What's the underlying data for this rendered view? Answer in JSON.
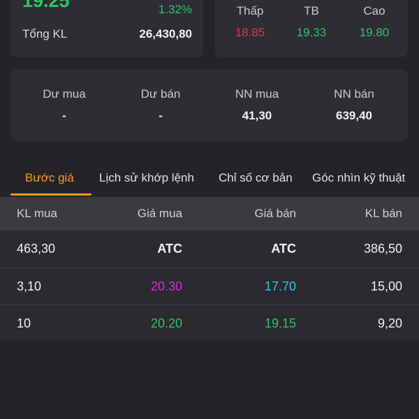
{
  "header": {
    "price_partial": "19.25",
    "change_pct": "1.32%",
    "volume_label": "Tổng KL",
    "volume_value": "26,430,80"
  },
  "range": {
    "low_label": "Thấp",
    "low_value": "18.85",
    "avg_label": "TB",
    "avg_value": "19.33",
    "high_label": "Cao",
    "high_value": "19.80"
  },
  "flow": {
    "items": [
      {
        "label": "Dư mua",
        "value": "-"
      },
      {
        "label": "Dư bán",
        "value": "-"
      },
      {
        "label": "NN mua",
        "value": "41,30"
      },
      {
        "label": "NN bán",
        "value": "639,40"
      }
    ]
  },
  "tabs": [
    {
      "label": "Bước giá"
    },
    {
      "label": "Lịch sử khớp lệnh"
    },
    {
      "label": "Chỉ số cơ bản"
    },
    {
      "label": "Góc nhìn kỹ thuật"
    }
  ],
  "book": {
    "headers": [
      "KL mua",
      "Giá mua",
      "Giá bán",
      "KL bán"
    ],
    "rows": [
      {
        "kl_mua": "463,30",
        "gia_mua": "ATC",
        "gia_ban": "ATC",
        "kl_ban": "386,50"
      },
      {
        "kl_mua": "3,10",
        "gia_mua": "20.30",
        "gia_ban": "17.70",
        "kl_ban": "15,00"
      },
      {
        "kl_mua": "10",
        "gia_mua": "20.20",
        "gia_ban": "19.15",
        "kl_ban": "9,20"
      }
    ]
  },
  "colors": {
    "up": "#2fc46b",
    "down": "#e8334f",
    "ceiling": "#d82fd8",
    "floor": "#36c6dc",
    "accent": "#f59a23"
  }
}
